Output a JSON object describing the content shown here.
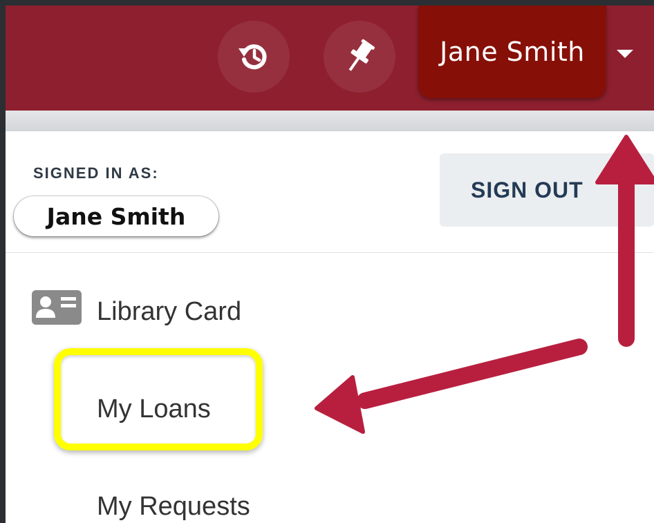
{
  "header": {
    "user_button_label": "Jane Smith",
    "icons": [
      "history-icon",
      "pushpin-icon",
      "caret-down-icon"
    ],
    "bar_color": "#8e1f2e",
    "user_button_color": "#861008"
  },
  "account_panel": {
    "signed_in_label": "SIGNED IN AS:",
    "user_name": "Jane Smith",
    "sign_out_label": "SIGN OUT"
  },
  "menu": {
    "section_label": "Library Card",
    "section_icon": "id-card-icon",
    "items": [
      "My Loans",
      "My Requests"
    ]
  },
  "annotations": {
    "highlight_color": "#ffff00",
    "arrow_color": "#b81f3f"
  }
}
